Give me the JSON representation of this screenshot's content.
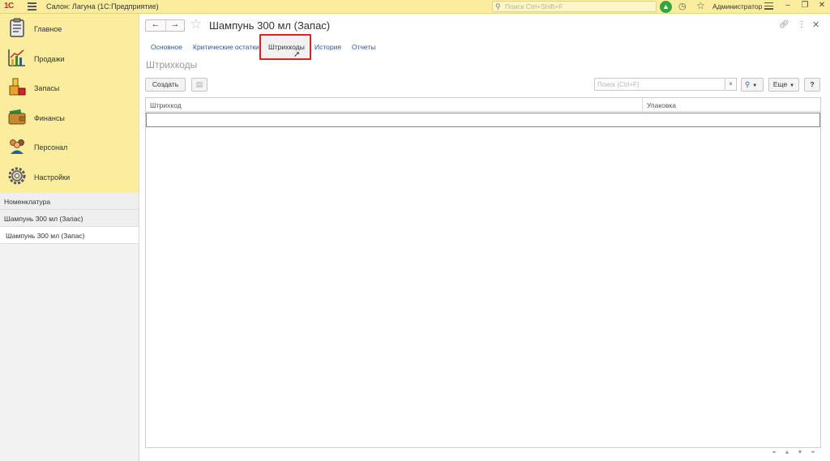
{
  "topbar": {
    "logo": "1С",
    "app_title": "Салон: Лагуна  (1С:Предприятие)",
    "search_placeholder": "Поиск Ctrl+Shift+F",
    "user": "Администратор"
  },
  "sidebar": {
    "sections": [
      {
        "label": "Главное",
        "icon": "clipboard-icon"
      },
      {
        "label": "Продажи",
        "icon": "sales-chart-icon"
      },
      {
        "label": "Запасы",
        "icon": "inventory-icon"
      },
      {
        "label": "Финансы",
        "icon": "wallet-icon"
      },
      {
        "label": "Персонал",
        "icon": "people-icon"
      },
      {
        "label": "Настройки",
        "icon": "gear-icon"
      }
    ],
    "nav_items": [
      {
        "label": "Номенклатура"
      },
      {
        "label": "Шампунь 300 мл (Запас)"
      },
      {
        "label": "Шампунь 300 мл (Запас)"
      }
    ]
  },
  "form": {
    "title": "Шампунь 300 мл (Запас)",
    "tabs": [
      {
        "label": "Основное"
      },
      {
        "label": "Критические остатки"
      },
      {
        "label": "Штрихкоды"
      },
      {
        "label": "История"
      },
      {
        "label": "Отчеты"
      }
    ],
    "section_title": "Штрихкоды",
    "toolbar": {
      "create_label": "Создать",
      "search_placeholder": "Поиск (Ctrl+F)",
      "clear_label": "×",
      "more_label": "Еще",
      "help_label": "?"
    },
    "table": {
      "columns": [
        "Штрихкод",
        "Упаковка"
      ],
      "rows": []
    }
  },
  "colors": {
    "topbar_bg": "#fbed9e",
    "link": "#2a59a6",
    "highlight": "#e0211f",
    "notification": "#34a541"
  }
}
